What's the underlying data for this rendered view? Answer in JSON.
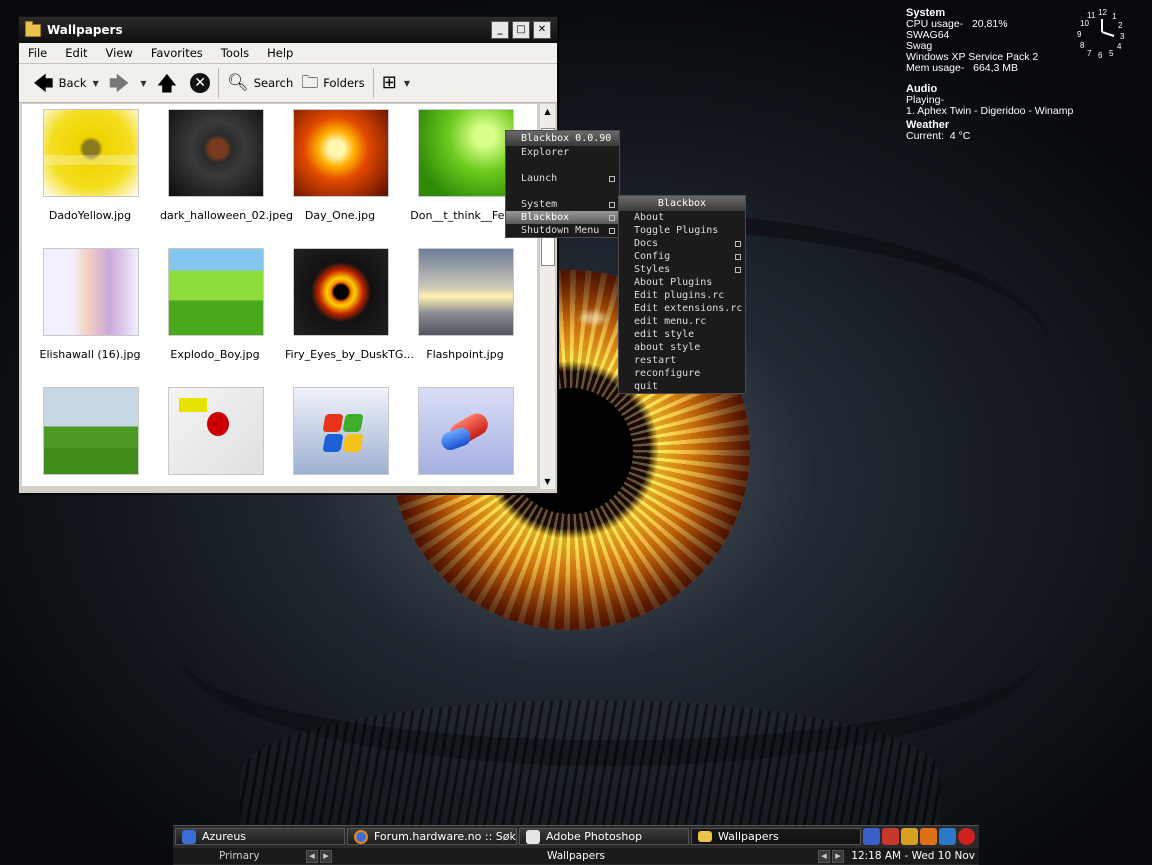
{
  "explorer": {
    "title": "Wallpapers",
    "menu": [
      "File",
      "Edit",
      "View",
      "Favorites",
      "Tools",
      "Help"
    ],
    "toolbar": {
      "back": "Back",
      "search": "Search",
      "folders": "Folders"
    },
    "files": [
      "DadoYellow.jpg",
      "dark_halloween_02.jpeg",
      "Day_One.jpg",
      "Don__t_think__Feel_",
      "Elishawall (16).jpg",
      "Explodo_Boy.jpg",
      "Firy_Eyes_by_DuskTG...",
      "Flashpoint.jpg",
      "",
      "",
      "",
      ""
    ]
  },
  "menu1": {
    "title": "Blackbox 0.0.90",
    "items": [
      "Explorer",
      "",
      "Launch",
      "",
      "System",
      "Blackbox",
      "Shutdown Menu"
    ]
  },
  "menu2": {
    "title": "Blackbox",
    "items": [
      "About",
      "Toggle Plugins",
      "Docs",
      "Config",
      "Styles",
      "About Plugins",
      "Edit plugins.rc",
      "Edit extensions.rc",
      "edit menu.rc",
      "edit style",
      "about style",
      "restart",
      "reconfigure",
      "quit"
    ]
  },
  "sysmon": {
    "system_title": "System",
    "cpu": "CPU usage-   20,81%",
    "host": "SWAG64",
    "user": "Swag",
    "os": "Windows XP Service Pack 2",
    "mem": "Mem usage-   664,3 MB",
    "audio_title": "Audio",
    "playing_label": "Playing-",
    "track": "1. Aphex Twin - Digeridoo - Winamp",
    "weather_title": "Weather",
    "current": "Current:  4 °C"
  },
  "clock_numbers": [
    "12",
    "1",
    "2",
    "3",
    "4",
    "5",
    "6",
    "7",
    "8",
    "9",
    "10",
    "11"
  ],
  "taskbar": {
    "tasks": [
      "Azureus",
      "Forum.hardware.no :: Søker...",
      "Adobe Photoshop",
      "Wallpapers"
    ],
    "workspace": "Primary",
    "window_name": "Wallpapers",
    "clock": "12:18 AM - Wed 10 Nov"
  }
}
